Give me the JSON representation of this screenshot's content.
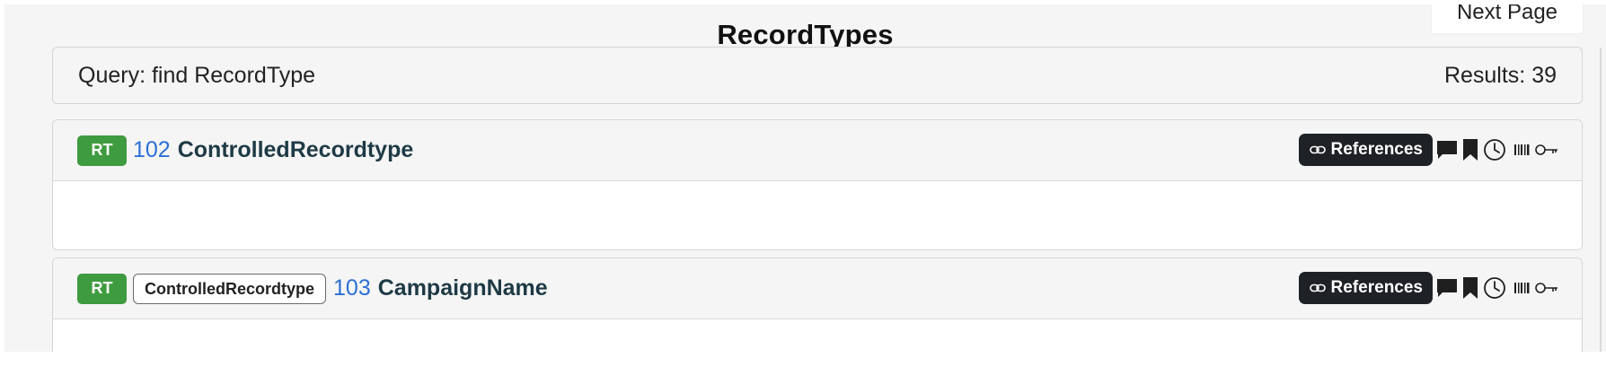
{
  "page": {
    "title": "RecordTypes",
    "next_page_label": "Next Page"
  },
  "query": {
    "label": "Query: find RecordType",
    "results": "Results: 39"
  },
  "records": [
    {
      "badge": "RT",
      "parent": "",
      "id": "102",
      "name": "ControlledRecordtype",
      "references_label": "References",
      "icons": [
        "link-icon",
        "comment-icon",
        "bookmark-icon",
        "history-icon",
        "barcode-icon",
        "key-icon"
      ]
    },
    {
      "badge": "RT",
      "parent": "ControlledRecordtype",
      "id": "103",
      "name": "CampaignName",
      "references_label": "References",
      "icons": [
        "link-icon",
        "comment-icon",
        "bookmark-icon",
        "history-icon",
        "barcode-icon",
        "key-icon"
      ]
    }
  ],
  "colors": {
    "badge_green": "#3f9b3f",
    "id_blue": "#2c6fd6",
    "name_dark": "#1e3a45",
    "references_bg": "#1e2125"
  }
}
